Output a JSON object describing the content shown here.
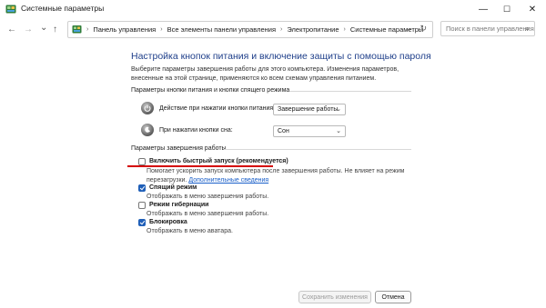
{
  "window": {
    "title": "Системные параметры",
    "icon": "control-panel-icon",
    "controls": {
      "minimize": "—",
      "maximize": "☐",
      "close": "✕"
    }
  },
  "address_bar": {
    "back": "←",
    "forward": "→",
    "history": "⌄",
    "up": "↑",
    "breadcrumbs": [
      "Панель управления",
      "Все элементы панели управления",
      "Электропитание",
      "Системные параметры"
    ],
    "history_drop": "⌄",
    "refresh": "↻",
    "search_placeholder": "Поиск в панели управления",
    "search_icon": "⌕"
  },
  "main": {
    "heading": "Настройка кнопок питания и включение защиты с помощью пароля",
    "description": "Выберите параметры завершения работы для этого компьютера. Изменения параметров, внесенные на этой странице, применяются ко всем схемам управления питанием.",
    "power_section": {
      "title": "Параметры кнопки питания и кнопки спящего режима",
      "rows": [
        {
          "label": "Действие при нажатии кнопки питания:",
          "value": "Завершение работы"
        },
        {
          "label": "При нажатии кнопки сна:",
          "value": "Сон"
        }
      ]
    },
    "shutdown_section": {
      "title": "Параметры завершения работы",
      "options": [
        {
          "label": "Включить быстрый запуск (рекомендуется)",
          "checked": false,
          "desc": "Помогает ускорить запуск компьютера после завершения работы. Не влияет на режим",
          "desc2": "перезагрузки.",
          "link": "Дополнительные сведения"
        },
        {
          "label": "Спящий режим",
          "checked": true,
          "desc": "Отображать в меню завершения работы."
        },
        {
          "label": "Режим гибернации",
          "checked": false,
          "desc": "Отображать в меню завершения работы."
        },
        {
          "label": "Блокировка",
          "checked": true,
          "desc": "Отображать в меню аватара."
        }
      ]
    }
  },
  "footer": {
    "save_label": "Сохранить изменения",
    "cancel_label": "Отмена"
  },
  "colors": {
    "heading": "#1f3f8a",
    "link": "#1a5fc9",
    "checkbox": "#1f5fb8",
    "highlight": "#d40000"
  }
}
